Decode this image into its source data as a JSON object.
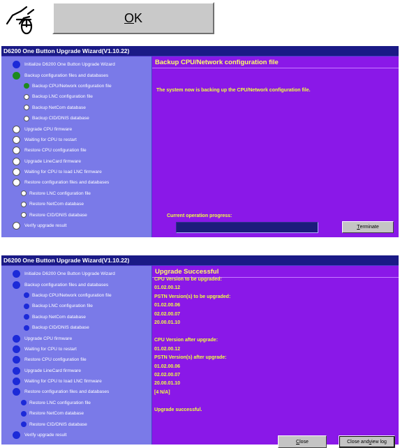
{
  "ok_button": {
    "label_underlined": "O",
    "label_rest": "K"
  },
  "window1": {
    "title": "D6200 One Button Upgrade Wizard(V1.10.22)",
    "steps": [
      {
        "label": "Initialize D6200 One Button Upgrade Wizard",
        "level": 0,
        "status": "done"
      },
      {
        "label": "Backup configuration files and databases",
        "level": 0,
        "status": "current"
      },
      {
        "label": "Backup CPU/Network configuration file",
        "level": 1,
        "status": "current"
      },
      {
        "label": "Backup LNC configuration file",
        "level": 1,
        "status": "pending"
      },
      {
        "label": "Backup NetCom database",
        "level": 1,
        "status": "pending"
      },
      {
        "label": "Backup CID/DNIS database",
        "level": 1,
        "status": "pending"
      },
      {
        "label": "Upgrade CPU firmware",
        "level": 0,
        "status": "pending"
      },
      {
        "label": "Waiting for CPU to restart",
        "level": 0,
        "status": "pending"
      },
      {
        "label": "Restore CPU configuration file",
        "level": 0,
        "status": "pending"
      },
      {
        "label": "Upgrade LineCard firmware",
        "level": 0,
        "status": "pending"
      },
      {
        "label": "Waiting for CPU to load LNC firmware",
        "level": 0,
        "status": "pending"
      },
      {
        "label": "Restore configuration files and databases",
        "level": 0,
        "status": "pending"
      },
      {
        "label": "Restore LNC configuration file",
        "level": 1,
        "status": "pending"
      },
      {
        "label": "Restore NetCom database",
        "level": 1,
        "status": "pending"
      },
      {
        "label": "Restore CID/DNIS database",
        "level": 1,
        "status": "pending"
      },
      {
        "label": "Verify upgrade result",
        "level": 0,
        "status": "pending"
      }
    ],
    "panel_title": "Backup CPU/Network configuration file",
    "message": "The system now is backing up the CPU/Network configuration file.",
    "progress_label": "Current operation progress:",
    "progress_fraction": 0,
    "terminate_underlined": "T",
    "terminate_rest": "erminate"
  },
  "window2": {
    "title": "D6200 One Button Upgrade Wizard(V1.10.22)",
    "steps": [
      {
        "label": "Initialize D6200 One Button Upgrade Wizard",
        "level": 0
      },
      {
        "label": "Backup configuration files and databases",
        "level": 0
      },
      {
        "label": "Backup CPU/Network configuration file",
        "level": 1
      },
      {
        "label": "Backup LNC configuration file",
        "level": 1
      },
      {
        "label": "Backup NetCom database",
        "level": 1
      },
      {
        "label": "Backup CID/DNIS database",
        "level": 1
      },
      {
        "label": "Upgrade CPU firmware",
        "level": 0
      },
      {
        "label": "Waiting for CPU to restart",
        "level": 0
      },
      {
        "label": "Restore CPU configuration file",
        "level": 0
      },
      {
        "label": "Upgrade LineCard firmware",
        "level": 0
      },
      {
        "label": "Waiting for CPU to load LNC firmware",
        "level": 0
      },
      {
        "label": "Restore configuration files and databases",
        "level": 0
      },
      {
        "label": "Restore LNC configuration file",
        "level": 1
      },
      {
        "label": "Restore NetCom database",
        "level": 1
      },
      {
        "label": "Restore CID/DNIS database",
        "level": 1
      },
      {
        "label": "Verify upgrade result",
        "level": 0
      }
    ],
    "panel_title": "Upgrade Successful",
    "lines": [
      "CPU Version to be upgraded:",
      "01.02.00.12",
      "PSTN Version(s) to be upgraded:",
      "01.02.00.06",
      "02.02.00.07",
      "20.00.01.10",
      "",
      "CPU Version after upgrade:",
      "01.02.00.12",
      "PSTN Version(s) after upgrade:",
      "01.02.00.06",
      "02.02.00.07",
      "20.00.01.10",
      "[4 N/A]",
      "",
      "Upgrade successful."
    ],
    "close_underlined": "C",
    "close_rest": "lose",
    "view_log_pre": "Close and ",
    "view_log_underlined": "v",
    "view_log_rest": "iew log"
  },
  "colors": {
    "title_bar": "#1a1a86",
    "left_panel": "#7a7ae8",
    "right_panel": "#8a18e8",
    "highlight_text": "#f0ff40",
    "step_done": "#1c2ad8",
    "step_current": "#1d8a1d"
  },
  "icons": {
    "cursor": "hand-mouse-click-icon"
  }
}
